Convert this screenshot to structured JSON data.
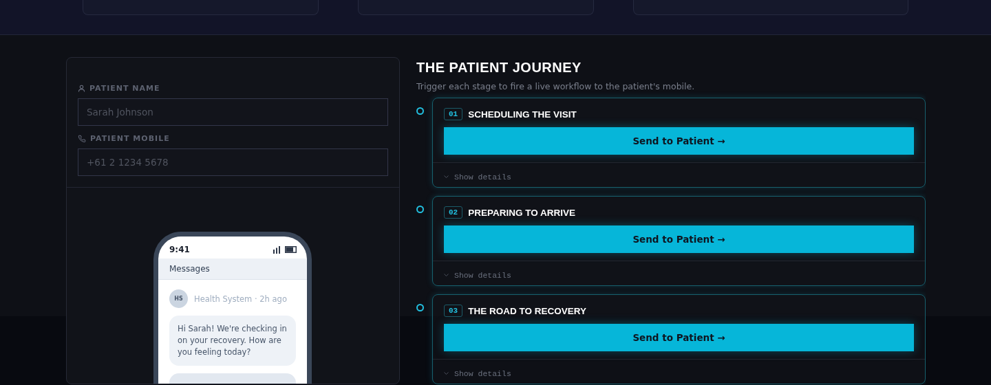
{
  "form": {
    "fields": [
      {
        "kind": "person",
        "label": "PATIENT NAME",
        "placeholder": "Sarah Johnson"
      },
      {
        "kind": "phone",
        "label": "PATIENT MOBILE",
        "placeholder": "+61 2 1234 5678"
      }
    ]
  },
  "phone": {
    "time": "9:41",
    "header": "Messages",
    "avatar": "HS",
    "sender": "Health System · 2h ago",
    "messages": [
      "Hi Sarah! We're checking in on your recovery. How are you feeling today?"
    ]
  },
  "journey": {
    "title": "THE PATIENT JOURNEY",
    "subtitle": "Trigger each stage to fire a live workflow to the patient's mobile.",
    "stages": [
      {
        "number": "01",
        "title": "SCHEDULING THE VISIT",
        "button": "Send to Patient →",
        "details": "Show details",
        "expanded": false
      },
      {
        "number": "02",
        "title": "PREPARING TO ARRIVE",
        "button": "Send to Patient →",
        "details": "Show details",
        "expanded": false
      },
      {
        "number": "03",
        "title": "THE ROAD TO RECOVERY",
        "button": "Send to Patient →",
        "details": "Show details",
        "expanded": false
      }
    ]
  }
}
